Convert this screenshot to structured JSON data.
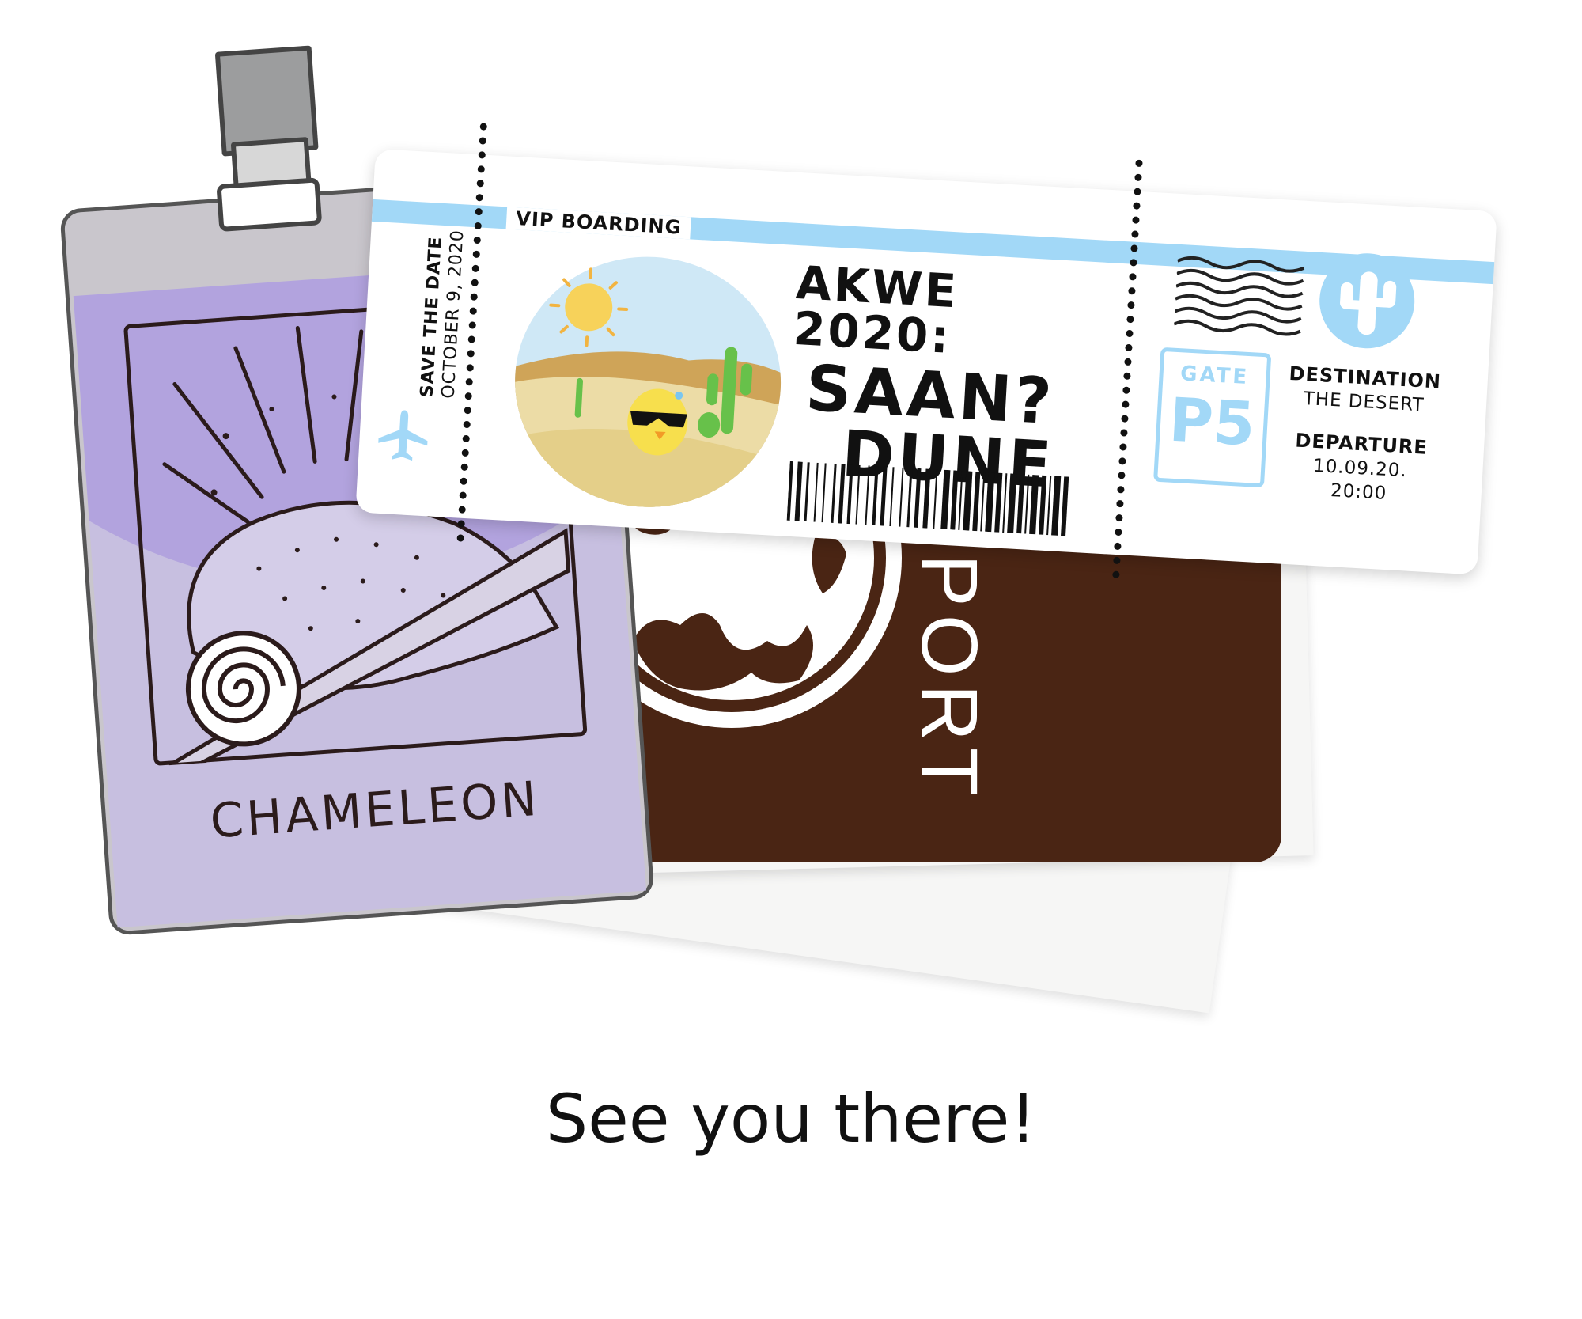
{
  "badge": {
    "label": "CHAMELEON",
    "clip_icon": "badge-clip-icon",
    "illustration_icon": "chameleon-illustration-icon"
  },
  "passport": {
    "partial_word": "PORT",
    "globe_icon": "globe-icon"
  },
  "ticket": {
    "boarding_label": "VIP BOARDING",
    "save_the_date": "SAVE THE DATE",
    "date": "OCTOBER 9, 2020",
    "plane_icon": "airplane-icon",
    "scene_icon": "desert-chick-scene-icon",
    "title_line1": "AKWE 2020:",
    "title_line2": "SAAN?",
    "title_line3": "DUNE",
    "barcode_icon": "barcode-icon",
    "postmark_icon": "postmark-icon",
    "cactus_icon": "cactus-icon",
    "gate_label": "GATE",
    "gate_value": "P5",
    "destination_label": "DESTINATION",
    "destination_value": "THE DESERT",
    "departure_label": "DEPARTURE",
    "departure_date": "10.09.20.",
    "departure_time": "20:00"
  },
  "caption": "See you there!",
  "colors": {
    "accent_blue": "#a2d8f7",
    "passport_brown": "#4a2514",
    "badge_purple": "#b2a3de",
    "badge_lavender": "#c7bfe0"
  }
}
